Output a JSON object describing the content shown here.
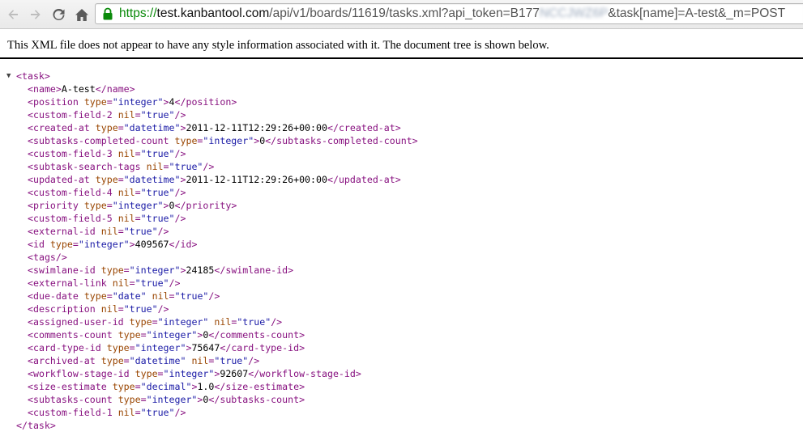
{
  "browser": {
    "url": {
      "scheme": "https://",
      "host": "test.kanbantool.com",
      "path": "/api/v1/boards/11619/tasks.xml?api_token=B177",
      "hidden": "NCCJWZ6P",
      "rest": "&task[name]=A-test&_m=POST"
    },
    "icons": {
      "back": "back-arrow-icon",
      "forward": "forward-arrow-icon",
      "reload": "reload-icon",
      "home": "home-icon",
      "lock": "lock-icon"
    }
  },
  "notice": "This XML file does not appear to have any style information associated with it. The document tree is shown below.",
  "xml": {
    "root": "task",
    "children": [
      {
        "name": "name",
        "attrs": [],
        "text": "A-test"
      },
      {
        "name": "position",
        "attrs": [
          [
            "type",
            "integer"
          ]
        ],
        "text": "4"
      },
      {
        "name": "custom-field-2",
        "attrs": [
          [
            "nil",
            "true"
          ]
        ],
        "self_closing": true
      },
      {
        "name": "created-at",
        "attrs": [
          [
            "type",
            "datetime"
          ]
        ],
        "text": "2011-12-11T12:29:26+00:00"
      },
      {
        "name": "subtasks-completed-count",
        "attrs": [
          [
            "type",
            "integer"
          ]
        ],
        "text": "0"
      },
      {
        "name": "custom-field-3",
        "attrs": [
          [
            "nil",
            "true"
          ]
        ],
        "self_closing": true
      },
      {
        "name": "subtask-search-tags",
        "attrs": [
          [
            "nil",
            "true"
          ]
        ],
        "self_closing": true
      },
      {
        "name": "updated-at",
        "attrs": [
          [
            "type",
            "datetime"
          ]
        ],
        "text": "2011-12-11T12:29:26+00:00"
      },
      {
        "name": "custom-field-4",
        "attrs": [
          [
            "nil",
            "true"
          ]
        ],
        "self_closing": true
      },
      {
        "name": "priority",
        "attrs": [
          [
            "type",
            "integer"
          ]
        ],
        "text": "0"
      },
      {
        "name": "custom-field-5",
        "attrs": [
          [
            "nil",
            "true"
          ]
        ],
        "self_closing": true
      },
      {
        "name": "external-id",
        "attrs": [
          [
            "nil",
            "true"
          ]
        ],
        "self_closing": true
      },
      {
        "name": "id",
        "attrs": [
          [
            "type",
            "integer"
          ]
        ],
        "text": "409567"
      },
      {
        "name": "tags",
        "attrs": [],
        "self_closing": true
      },
      {
        "name": "swimlane-id",
        "attrs": [
          [
            "type",
            "integer"
          ]
        ],
        "text": "24185"
      },
      {
        "name": "external-link",
        "attrs": [
          [
            "nil",
            "true"
          ]
        ],
        "self_closing": true
      },
      {
        "name": "due-date",
        "attrs": [
          [
            "type",
            "date"
          ],
          [
            "nil",
            "true"
          ]
        ],
        "self_closing": true
      },
      {
        "name": "description",
        "attrs": [
          [
            "nil",
            "true"
          ]
        ],
        "self_closing": true
      },
      {
        "name": "assigned-user-id",
        "attrs": [
          [
            "type",
            "integer"
          ],
          [
            "nil",
            "true"
          ]
        ],
        "self_closing": true
      },
      {
        "name": "comments-count",
        "attrs": [
          [
            "type",
            "integer"
          ]
        ],
        "text": "0"
      },
      {
        "name": "card-type-id",
        "attrs": [
          [
            "type",
            "integer"
          ]
        ],
        "text": "75647"
      },
      {
        "name": "archived-at",
        "attrs": [
          [
            "type",
            "datetime"
          ],
          [
            "nil",
            "true"
          ]
        ],
        "self_closing": true
      },
      {
        "name": "workflow-stage-id",
        "attrs": [
          [
            "type",
            "integer"
          ]
        ],
        "text": "92607"
      },
      {
        "name": "size-estimate",
        "attrs": [
          [
            "type",
            "decimal"
          ]
        ],
        "text": "1.0"
      },
      {
        "name": "subtasks-count",
        "attrs": [
          [
            "type",
            "integer"
          ]
        ],
        "text": "0"
      },
      {
        "name": "custom-field-1",
        "attrs": [
          [
            "nil",
            "true"
          ]
        ],
        "self_closing": true
      }
    ]
  },
  "colors": {
    "tag": "#881280",
    "attr_name": "#994500",
    "attr_value": "#1a1aa6",
    "secure_scheme": "#0a8a0a"
  }
}
